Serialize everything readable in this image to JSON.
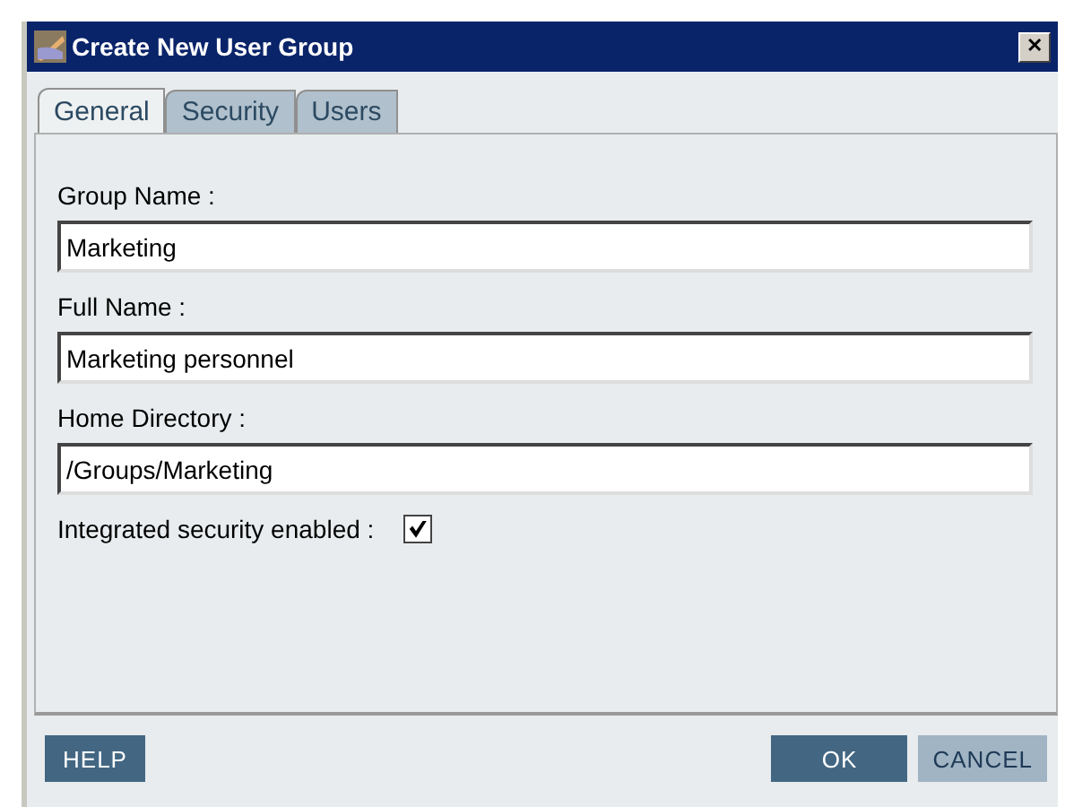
{
  "window": {
    "title": "Create New User Group",
    "close": "✕"
  },
  "tabs": [
    {
      "label": "General",
      "selected": true
    },
    {
      "label": "Security",
      "selected": false
    },
    {
      "label": "Users",
      "selected": false
    }
  ],
  "fields": [
    {
      "label": "Group Name :",
      "value": "Marketing"
    },
    {
      "label": "Full Name :",
      "value": "Marketing personnel"
    },
    {
      "label": "Home Directory :",
      "value": "/Groups/Marketing"
    }
  ],
  "checkbox": {
    "label": "Integrated security enabled :",
    "checked": true
  },
  "footer_left": [
    {
      "label": "HELP",
      "kind": "primary"
    }
  ],
  "footer_right": [
    {
      "label": "OK",
      "kind": "primary"
    },
    {
      "label": "CANCEL",
      "kind": "secondary"
    }
  ]
}
